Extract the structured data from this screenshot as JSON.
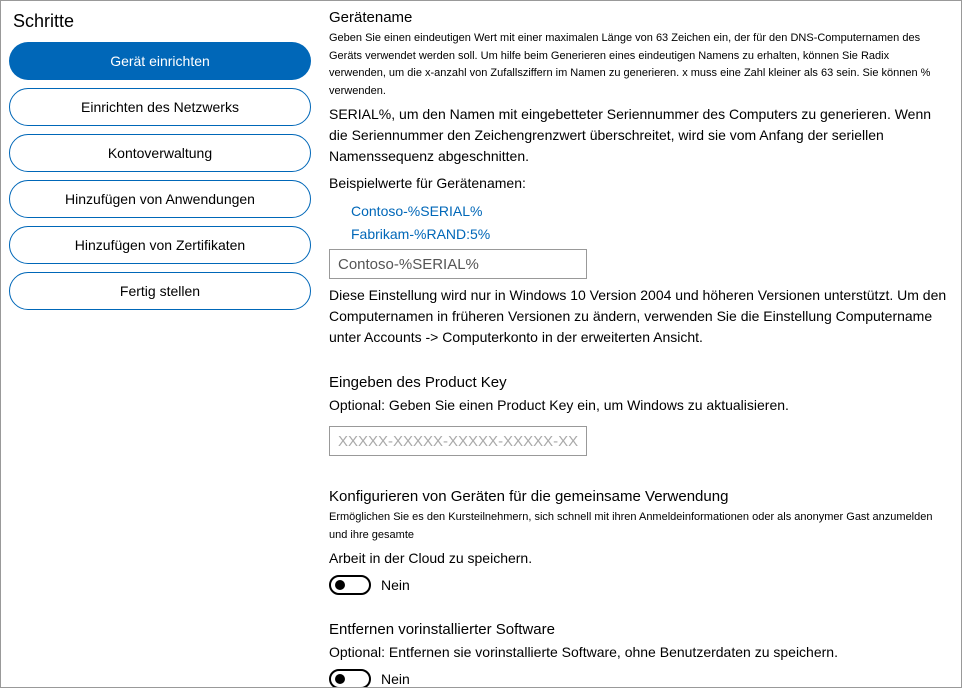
{
  "sidebar": {
    "title": "Schritte",
    "steps": [
      "Gerät einrichten",
      "Einrichten des Netzwerks",
      "Kontoverwaltung",
      "Hinzufügen von Anwendungen",
      "Hinzufügen von Zertifikaten",
      "Fertig stellen"
    ]
  },
  "device_name": {
    "title": "Gerätename",
    "desc": "Geben Sie einen eindeutigen Wert mit einer maximalen Länge von 63 Zeichen ein, der für den DNS-Computernamen des Geräts verwendet werden soll. Um hilfe beim Generieren eines eindeutigen Namens zu erhalten, können Sie Radix verwenden, um die x-anzahl von Zufallsziffern im Namen zu generieren. x muss eine Zahl kleiner als 63 sein. Sie können % verwenden.",
    "serial_note": "SERIAL%, um den Namen mit eingebetteter Seriennummer des Computers zu generieren. Wenn die Seriennummer den Zeichengrenzwert überschreitet, wird sie vom Anfang der seriellen Namenssequenz abgeschnitten.",
    "examples_label": "Beispielwerte für Gerätenamen:",
    "example1": "Contoso-%SERIAL%",
    "example2": "Fabrikam-%RAND:5%",
    "input_value": "Contoso-%SERIAL%",
    "post_note": "Diese Einstellung wird nur in Windows 10 Version 2004 und höheren Versionen unterstützt. Um den Computernamen in früheren Versionen zu ändern, verwenden Sie die Einstellung Computername unter Accounts -> Computerkonto in der erweiterten Ansicht."
  },
  "product_key": {
    "title": "Eingeben des Product Key",
    "desc": "Optional: Geben Sie einen Product Key ein, um Windows zu aktualisieren.",
    "placeholder": "XXXXX-XXXXX-XXXXX-XXXXX-XXXXX"
  },
  "shared_use": {
    "title": "Konfigurieren von Geräten für die gemeinsame Verwendung",
    "desc": "Ermöglichen Sie es den Kursteilnehmern, sich schnell mit ihren Anmeldeinformationen oder als anonymer Gast anzumelden und ihre gesamte",
    "desc2": "Arbeit in der Cloud zu speichern.",
    "toggle_label": "Nein"
  },
  "remove_software": {
    "title": "Entfernen vorinstallierter Software",
    "desc": "Optional: Entfernen sie vorinstallierte Software, ohne Benutzerdaten zu speichern.",
    "toggle_label": "Nein"
  }
}
